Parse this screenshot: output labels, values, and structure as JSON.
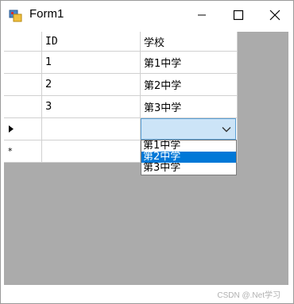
{
  "window": {
    "title": "Form1"
  },
  "grid": {
    "columns": [
      "ID",
      "学校"
    ],
    "rows": [
      {
        "id": "1",
        "school": "第1中学"
      },
      {
        "id": "2",
        "school": "第2中学"
      },
      {
        "id": "3",
        "school": "第3中学"
      }
    ],
    "row_header_current": "▶",
    "row_header_new": "*"
  },
  "combo": {
    "value": "",
    "options": [
      "第1中学",
      "第2中学",
      "第3中学"
    ],
    "selected_index": 1
  },
  "watermark": "CSDN @.Net学习"
}
